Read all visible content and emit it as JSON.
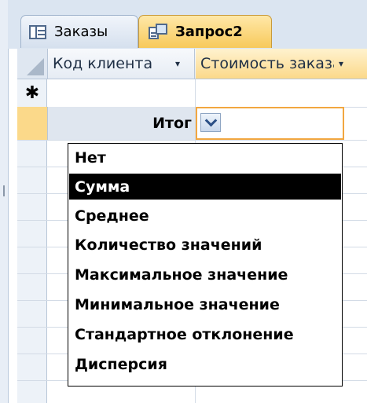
{
  "tabs": [
    {
      "label": "Заказы",
      "icon": "table-icon",
      "active": false
    },
    {
      "label": "Запрос2",
      "icon": "query-icon",
      "active": true
    }
  ],
  "columns": [
    {
      "label": "Код клиента",
      "arrow": "▾"
    },
    {
      "label": "Стоимость заказа",
      "arrow": "▾"
    }
  ],
  "new_row_marker": "✱",
  "total_row": {
    "label": "Итог",
    "value": ""
  },
  "dropdown": {
    "options": [
      "Нет",
      "Сумма",
      "Среднее",
      "Количество значений",
      "Максимальное значение",
      "Минимальное значение",
      "Стандартное отклонение",
      "Дисперсия"
    ],
    "selected": "Сумма"
  },
  "colors": {
    "active_tab": "#f7c95b",
    "selection": "#000000",
    "focus_border": "#f2a740",
    "header_bg": "#e6ecf4"
  }
}
